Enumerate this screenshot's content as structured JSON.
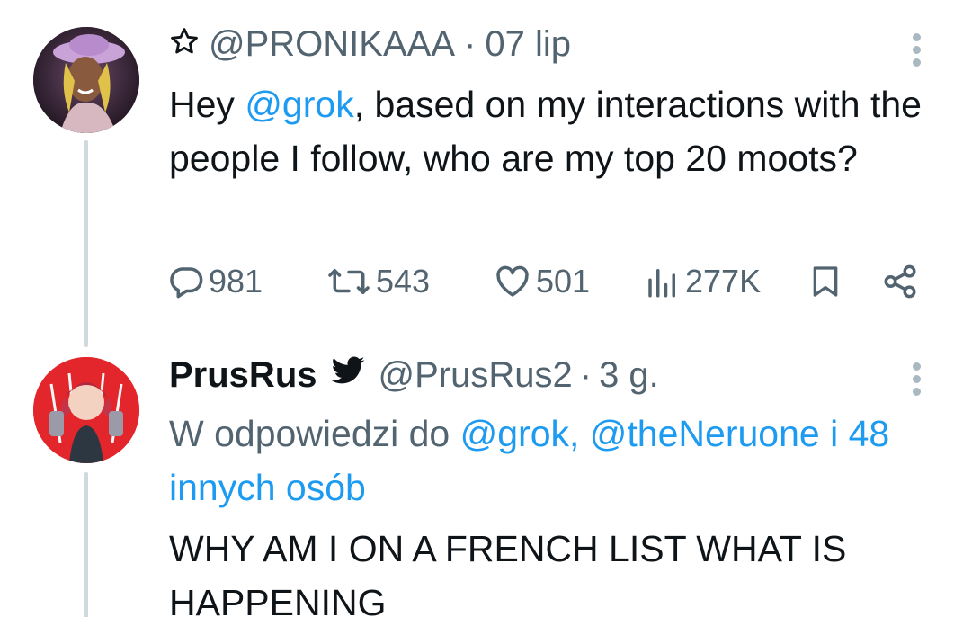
{
  "tweet1": {
    "handle": "@PRONIKAAA",
    "separator": "·",
    "time": "07 lip",
    "text_before": "Hey ",
    "mention": "@grok",
    "text_after": ", based on my interactions with the people I follow, who are my top 20 moots?",
    "stats": {
      "replies": "981",
      "reposts": "543",
      "likes": "501",
      "views": "277K"
    }
  },
  "tweet2": {
    "name": "PrusRus",
    "handle": "@PrusRus2",
    "separator": "·",
    "time": "3 g.",
    "reply_prefix": "W odpowiedzi do ",
    "reply_mentions": "@grok, @theNeruone i 48 innych osób",
    "text": "WHY AM I ON A FRENCH LIST WHAT IS HAPPENING"
  },
  "icons": {
    "star": "star-outline-icon",
    "more": "more-vertical-icon",
    "reply": "reply-icon",
    "repost": "repost-icon",
    "like": "heart-icon",
    "views": "views-icon",
    "bookmark": "bookmark-icon",
    "share": "share-icon",
    "twitter": "twitter-bird-icon"
  },
  "colors": {
    "accent": "#1d9bf0",
    "muted": "#536471",
    "thread_line": "#cfd9de"
  }
}
